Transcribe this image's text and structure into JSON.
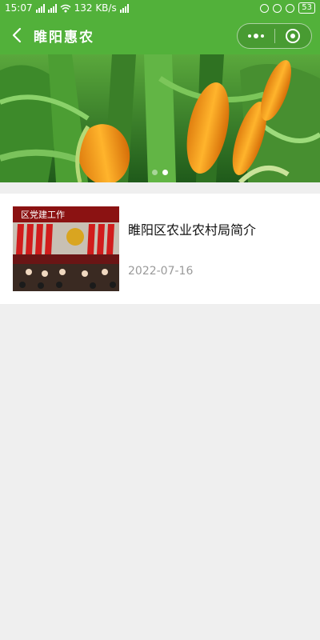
{
  "status_bar": {
    "time": "15:07",
    "speed": "132 KB/s",
    "battery": "53",
    "icons": [
      "signal-icon",
      "signal-icon",
      "wifi-icon",
      "signal-icon",
      "alarm-icon",
      "battery-icon"
    ]
  },
  "nav": {
    "title": "睢阳惠农",
    "back_icon": "chevron-left-icon",
    "more_icon": "more-dots-icon",
    "close_icon": "target-circle-icon",
    "color": "#52b13a"
  },
  "banner": {
    "image": "corn-field",
    "dot_count": 2,
    "active_dot": 1
  },
  "articles": [
    {
      "title": "睢阳区农业农村局简介",
      "date": "2022-07-16",
      "thumb_caption": "区党建工作"
    }
  ]
}
